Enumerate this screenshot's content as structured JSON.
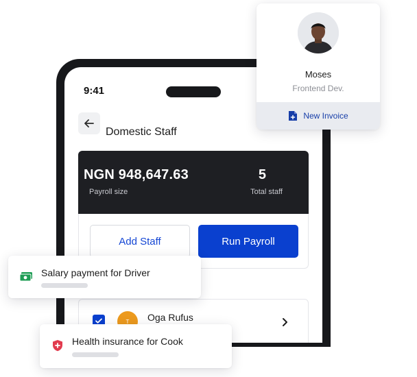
{
  "phone": {
    "status_time": "9:41",
    "header": {
      "title": "Domestic Staff",
      "back_icon": "arrow-left-icon"
    },
    "summary": {
      "payroll_amount": "NGN 948,647.63",
      "payroll_label": "Payroll size",
      "total_staff": "5",
      "total_staff_label": "Total staff"
    },
    "actions": {
      "add_staff_label": "Add Staff",
      "run_payroll_label": "Run Payroll"
    },
    "staff_list": [
      {
        "initial": "T",
        "name": "Oga Rufus",
        "checked": true
      }
    ]
  },
  "profile_card": {
    "name": "Moses",
    "role": "Frontend Dev.",
    "invoice_label": "New Invoice",
    "invoice_icon": "document-plus-icon"
  },
  "notifications": [
    {
      "text": "Salary payment for Driver",
      "icon": "money-icon"
    },
    {
      "text": "Health insurance for Cook",
      "icon": "shield-cross-icon"
    }
  ],
  "colors": {
    "primary": "#0a40cf",
    "dark_panel": "#1e1f23",
    "phone_frame": "#17181b",
    "money_green": "#1f9d55",
    "shield_red": "#e23b4e",
    "avatar_orange": "#ec9a1e"
  }
}
